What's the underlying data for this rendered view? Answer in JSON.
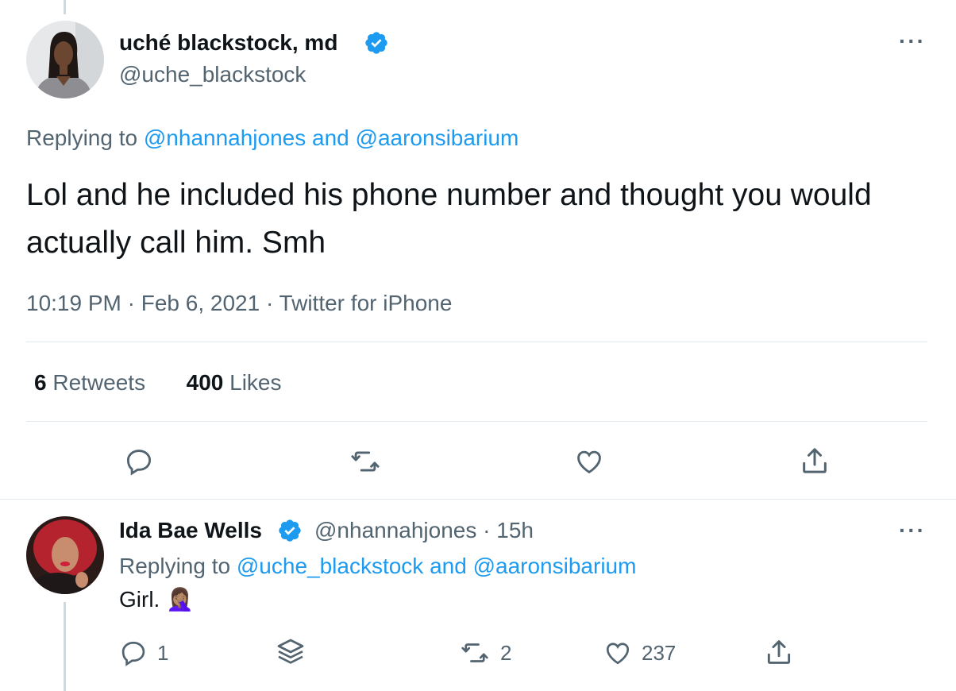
{
  "main_tweet": {
    "display_name": "uché blackstock, md",
    "handle": "@uche_blackstock",
    "replying_prefix": "Replying to",
    "replying_to_1": "@nhannahjones",
    "replying_and": "and",
    "replying_to_2": "@aaronsibarium",
    "text": "Lol and he included his phone number and thought you would actually call him. Smh",
    "timestamp": "10:19 PM · Feb 6, 2021 · Twitter for iPhone",
    "retweets_count": "6",
    "retweets_label": "Retweets",
    "likes_count": "400",
    "likes_label": "Likes",
    "more_label": "···"
  },
  "reply_tweet": {
    "display_name": "Ida Bae Wells",
    "handle_time": "@nhannahjones · 15h",
    "replying_prefix": "Replying to",
    "replying_to_1": "@uche_blackstock",
    "replying_and": "and",
    "replying_to_2": "@aaronsibarium",
    "text": "Girl. 🤦🏽‍♀️",
    "reply_count": "1",
    "retweet_count": "2",
    "like_count": "237",
    "more_label": "···"
  },
  "icons": {
    "verified": "verified-badge-icon",
    "reply": "reply-icon",
    "retweet": "retweet-icon",
    "like": "heart-icon",
    "share": "share-icon",
    "thread": "thread-layers-icon"
  },
  "colors": {
    "accent": "#1d9bf0",
    "muted": "#536471",
    "text": "#0f1419",
    "divider": "#e1e8ed"
  }
}
